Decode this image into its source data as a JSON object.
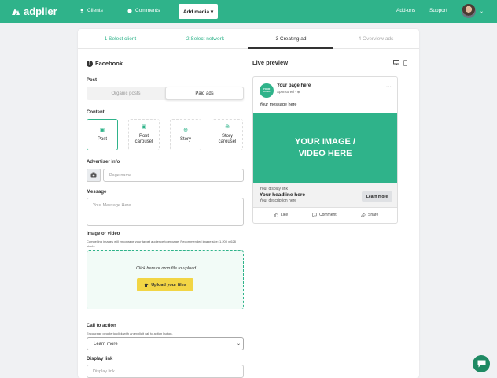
{
  "nav": {
    "logo": "adpiler",
    "clients": "Clients",
    "comments": "Comments",
    "add_media": "Add media ▾",
    "addons": "Add-ons",
    "support": "Support"
  },
  "steps": [
    "1 Select client",
    "2 Select network",
    "3 Creating ad",
    "4 Overview ads"
  ],
  "form": {
    "network": "Facebook",
    "post_label": "Post",
    "toggle": [
      "Organic posts",
      "Paid ads"
    ],
    "content_label": "Content",
    "content_types": [
      "Post",
      "Post\ncarousel",
      "Story",
      "Story\ncarousel"
    ],
    "advertiser_label": "Advertiser info",
    "page_name_placeholder": "Page name",
    "message_label": "Message",
    "message_placeholder": "Your Message Here",
    "image_label": "Image or video",
    "image_hint": "Compelling images will encourage your target audience to engage. Recommended image size: 1,200 x 628 pixels.",
    "dropzone_text": "Click here or drop file to upload",
    "upload_button": "Upload your files",
    "cta_label": "Call to action",
    "cta_hint": "Encourage people to click with an explicit call to action button.",
    "cta_value": "Learn more",
    "display_link_label": "Display link",
    "display_link_placeholder": "Display link"
  },
  "preview": {
    "title": "Live preview",
    "logo_text": "YOUR LOGO",
    "page_name": "Your page here",
    "sponsored": "Sponsored · ",
    "message": "Your message here",
    "image_text": "YOUR IMAGE / VIDEO HERE",
    "display_link": "Your display link",
    "headline": "Your headline here",
    "description": "Your description here",
    "learn_more": "Learn more",
    "actions": [
      "Like",
      "Comment",
      "Share"
    ]
  },
  "colors": {
    "brand": "#2fb38a",
    "upload": "#f2d545"
  }
}
